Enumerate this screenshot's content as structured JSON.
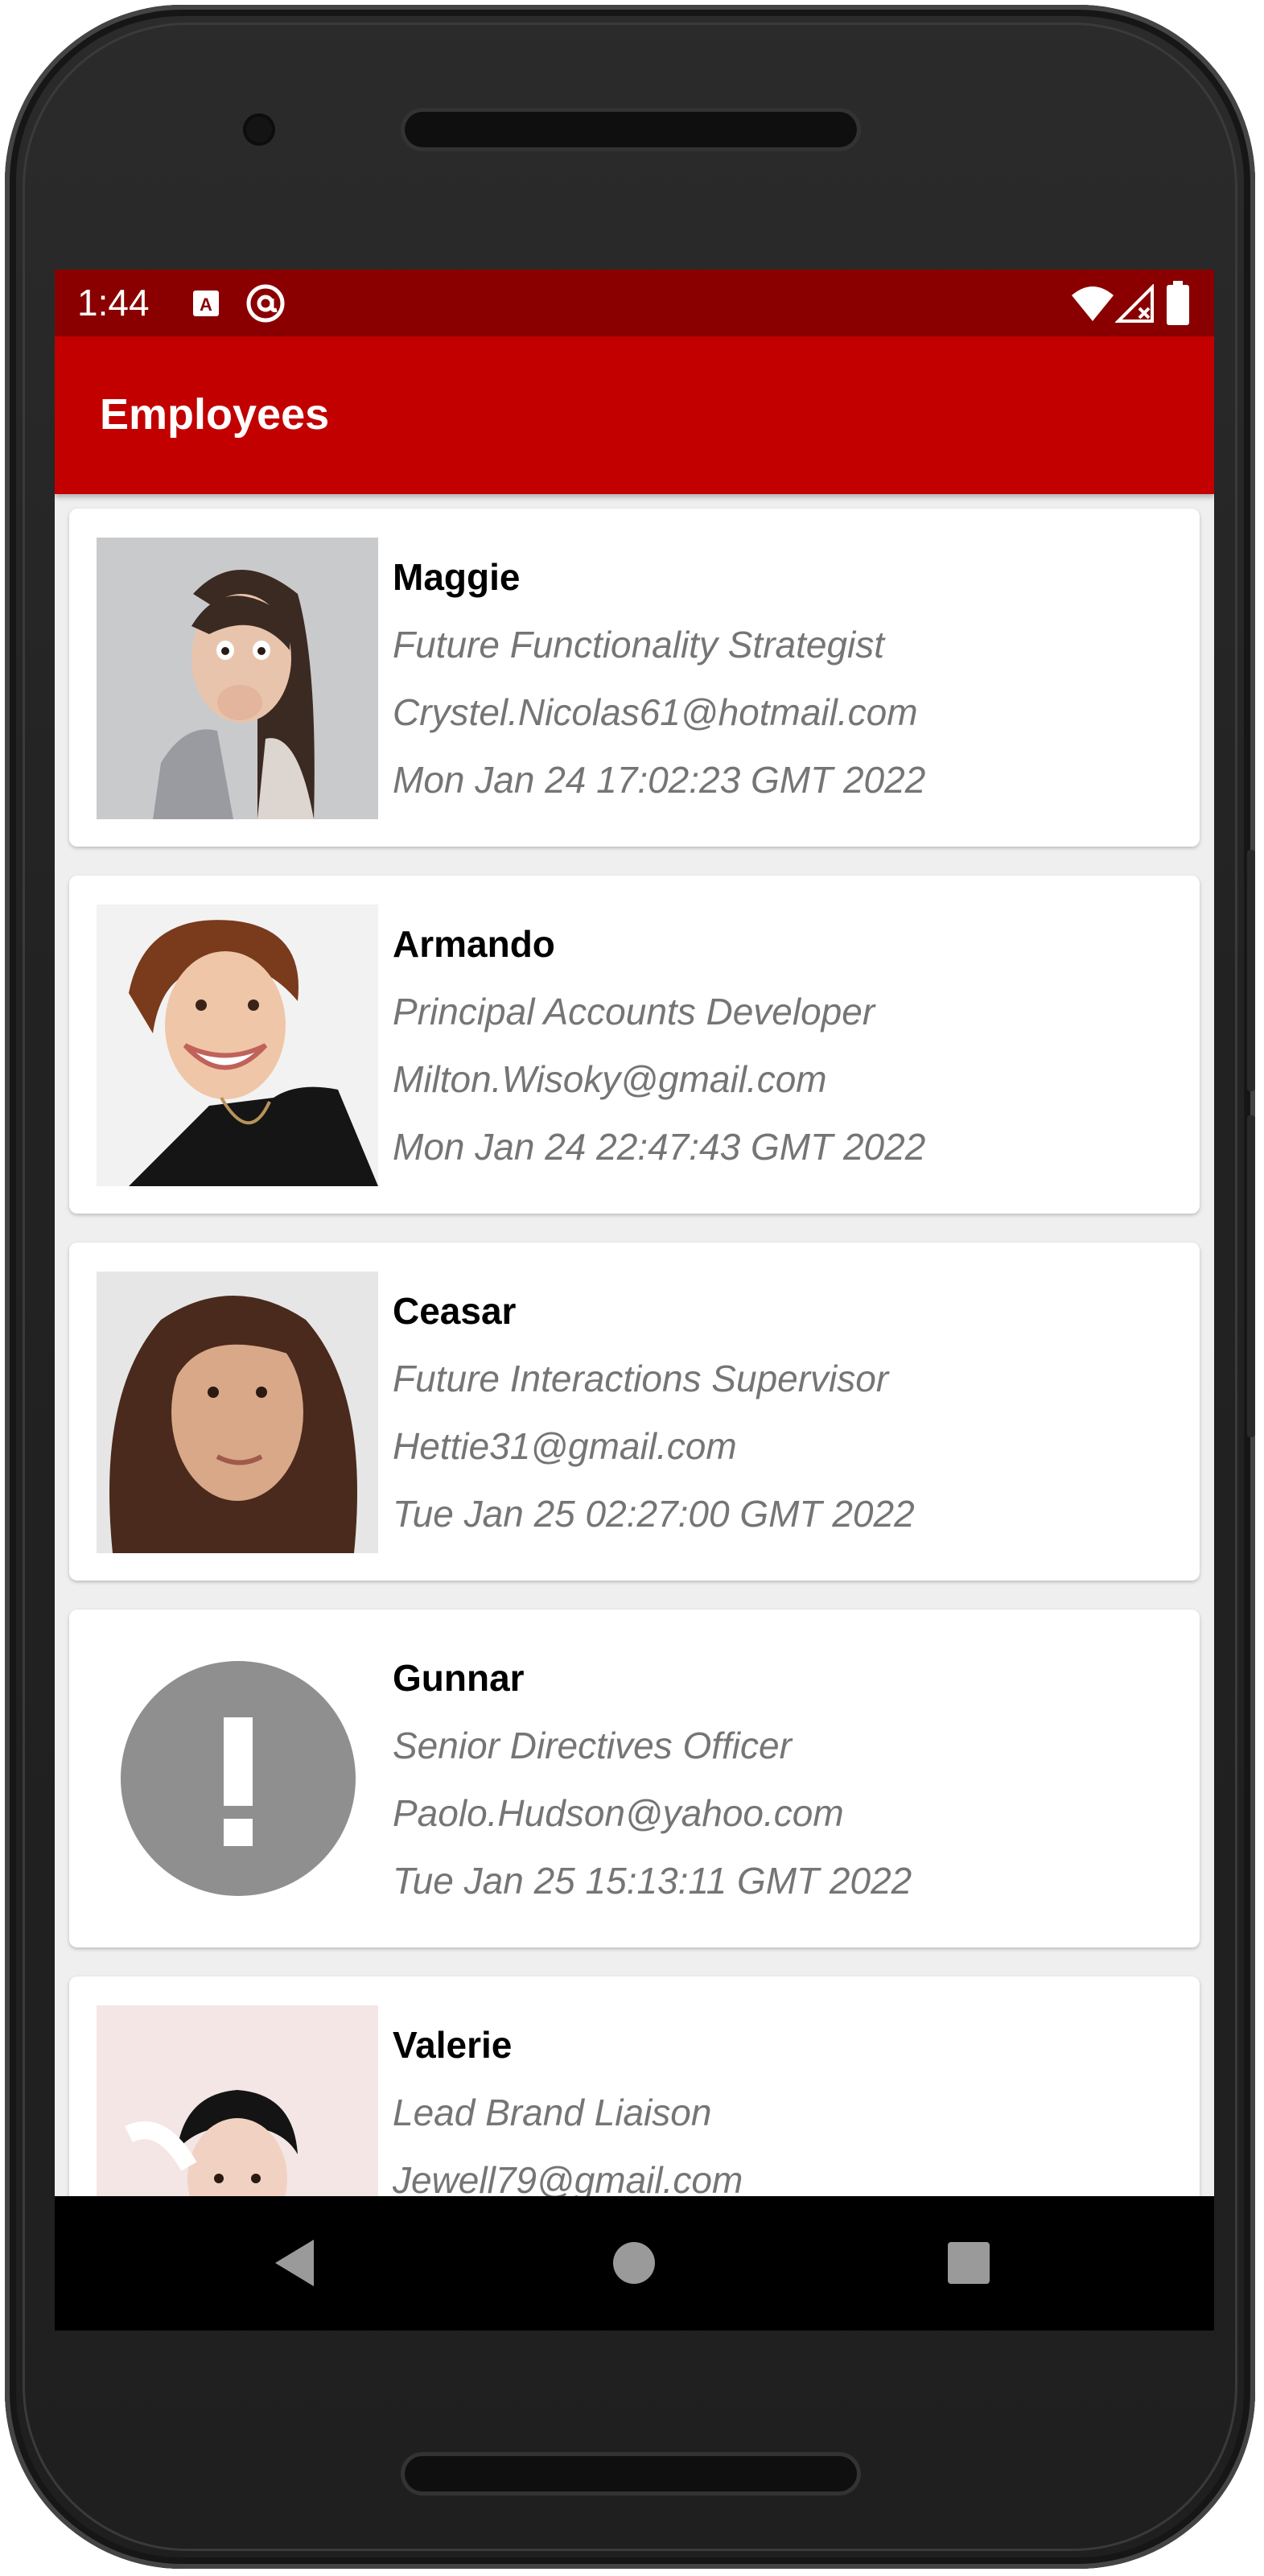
{
  "status_bar": {
    "time": "1:44"
  },
  "app_bar": {
    "title": "Employees"
  },
  "employees": [
    {
      "name": "Maggie",
      "title": "Future Functionality Strategist",
      "email": "Crystel.Nicolas61@hotmail.com",
      "date": "Mon Jan 24 17:02:23 GMT 2022"
    },
    {
      "name": "Armando",
      "title": "Principal Accounts Developer",
      "email": "Milton.Wisoky@gmail.com",
      "date": "Mon Jan 24 22:47:43 GMT 2022"
    },
    {
      "name": "Ceasar",
      "title": "Future Interactions Supervisor",
      "email": "Hettie31@gmail.com",
      "date": "Tue Jan 25 02:27:00 GMT 2022"
    },
    {
      "name": "Gunnar",
      "title": "Senior Directives Officer",
      "email": "Paolo.Hudson@yahoo.com",
      "date": "Tue Jan 25 15:13:11 GMT 2022"
    },
    {
      "name": "Valerie",
      "title": "Lead Brand Liaison",
      "email": "Jewell79@gmail.com",
      "date": ""
    }
  ],
  "colors": {
    "status_bar": "#8a0000",
    "app_bar": "#c20000",
    "placeholder": "#8f8f8f"
  },
  "icons": {
    "status_left": [
      "a-notification-icon",
      "at-sign-icon"
    ],
    "status_right": [
      "wifi-icon",
      "signal-icon",
      "battery-icon"
    ],
    "nav": [
      "back-icon",
      "home-icon",
      "recents-icon"
    ],
    "placeholder": "error-exclamation-icon"
  }
}
